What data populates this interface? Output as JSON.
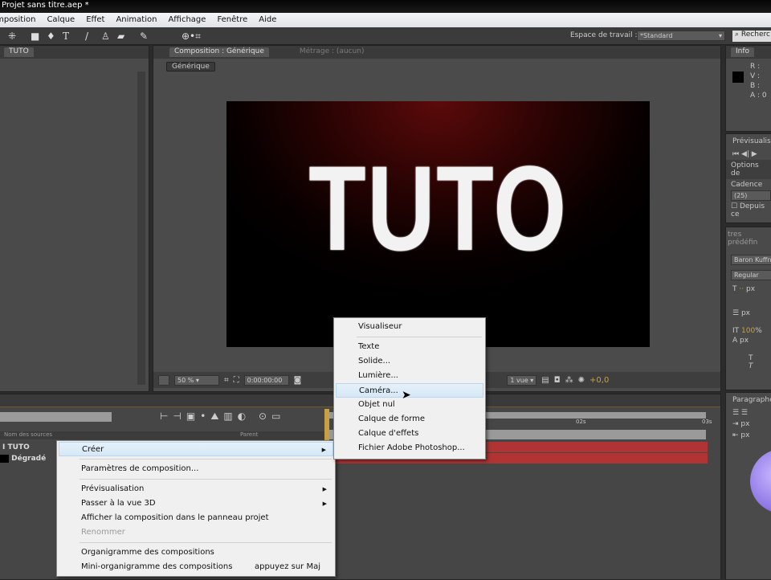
{
  "window": {
    "title": "Projet sans titre.aep *"
  },
  "menubar": [
    "Composition",
    "Calque",
    "Effet",
    "Animation",
    "Affichage",
    "Fenêtre",
    "Aide"
  ],
  "toolbar": {
    "workspace_label": "Espace de travail :",
    "workspace_value": "*Standard",
    "search_placeholder": "Recherc"
  },
  "project_panel": {
    "tab": "TUTO"
  },
  "composition_panel": {
    "tab": "Composition : Générique",
    "footage_tab": "Métrage : (aucun)",
    "subtab": "Générique",
    "canvas_text": "TUTO",
    "zoom": "50 %",
    "timecode": "0:00:00:00",
    "view": "1 vue",
    "exposure": "+0,0"
  },
  "info_panel": {
    "tab": "Info",
    "r": "R :",
    "v": "V :",
    "b": "B :",
    "a": "A : 0"
  },
  "preview_panel": {
    "title": "Prévisualis",
    "options": "Options de",
    "cadence_label": "Cadence",
    "cadence_value": "(25)",
    "from_current": "Depuis ce"
  },
  "character_panel": {
    "title": "tres prédéfin",
    "font": "Baron Kuffn",
    "style": "Regular",
    "size_unit": "px",
    "leading_unit": "px",
    "scale": "100",
    "scale_unit": "%",
    "baseline_unit": "px"
  },
  "paragraph_panel": {
    "title": "Paragraphe",
    "indent1": "px",
    "indent2": "px"
  },
  "timeline": {
    "col_source": "Nom des sources",
    "col_parent": "Parent",
    "layers": [
      {
        "name": "TUTO"
      },
      {
        "name": "Dégradé"
      }
    ],
    "ticks": [
      "02s",
      "03s"
    ]
  },
  "context_menu": {
    "items": [
      {
        "label": "Créer",
        "submenu": true,
        "highlighted": true
      },
      {
        "sep": true
      },
      {
        "label": "Paramètres de composition..."
      },
      {
        "sep": true
      },
      {
        "label": "Prévisualisation",
        "submenu": true
      },
      {
        "label": "Passer à la vue 3D",
        "submenu": true
      },
      {
        "label": "Afficher la composition dans le panneau projet"
      },
      {
        "label": "Renommer",
        "disabled": true
      },
      {
        "sep": true
      },
      {
        "label": "Organigramme des compositions"
      },
      {
        "label": "Mini-organigramme des compositions",
        "shortcut": "appuyez sur Maj"
      }
    ]
  },
  "submenu": {
    "items": [
      {
        "label": "Visualiseur"
      },
      {
        "sep": true
      },
      {
        "label": "Texte"
      },
      {
        "label": "Solide..."
      },
      {
        "label": "Lumière..."
      },
      {
        "label": "Caméra...",
        "highlighted": true
      },
      {
        "label": "Objet nul"
      },
      {
        "label": "Calque de forme"
      },
      {
        "label": "Calque d'effets"
      },
      {
        "label": "Fichier Adobe Photoshop..."
      }
    ]
  }
}
